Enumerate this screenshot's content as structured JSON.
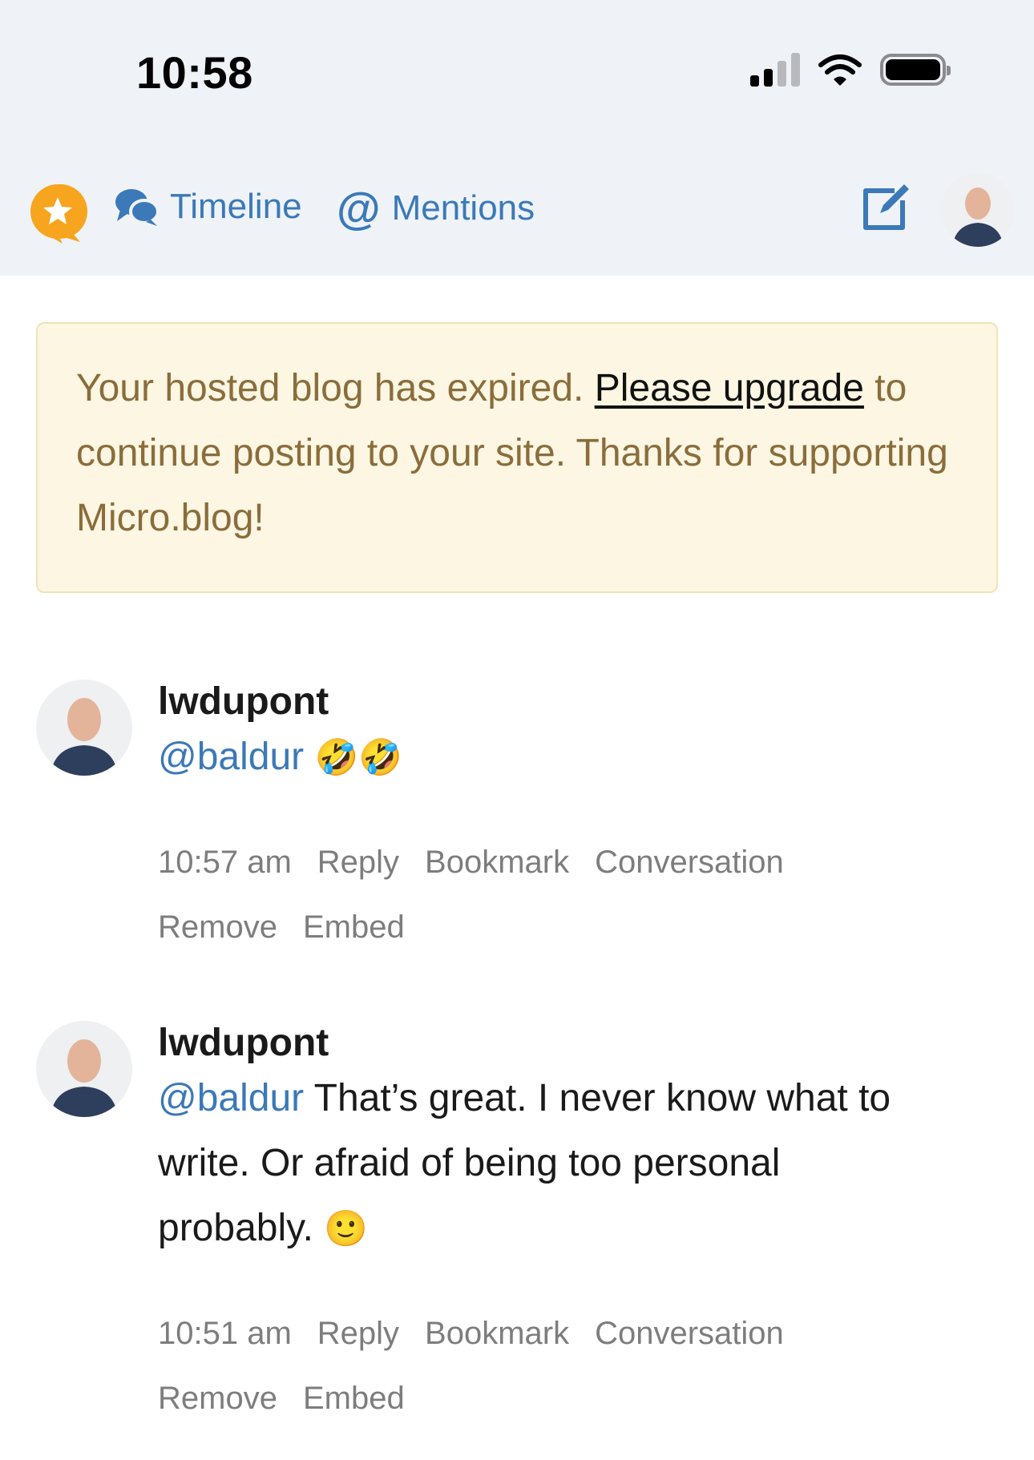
{
  "status": {
    "time": "10:58"
  },
  "nav": {
    "timeline": "Timeline",
    "mentions": "Mentions",
    "at_symbol": "@"
  },
  "banner": {
    "text_before": "Your hosted blog has expired. ",
    "link": "Please upgrade",
    "text_after": " to continue posting to your site. Thanks for supporting Micro.blog!"
  },
  "posts": [
    {
      "username": "lwdupont",
      "mention": "@baldur",
      "text": "",
      "emoji": "🤣🤣",
      "time": "10:57 am",
      "actions": [
        "Reply",
        "Bookmark",
        "Conversation",
        "Remove",
        "Embed"
      ]
    },
    {
      "username": "lwdupont",
      "mention": "@baldur",
      "text": " That’s great. I never know what to write. Or afraid of being too personal probably. ",
      "emoji": "🙂",
      "time": "10:51 am",
      "actions": [
        "Reply",
        "Bookmark",
        "Conversation",
        "Remove",
        "Embed"
      ]
    }
  ],
  "colors": {
    "accent": "#3b79b8",
    "banner_bg": "#fcf6e3",
    "banner_text": "#8a6d3b",
    "meta": "#7d7d7d"
  },
  "icons": {
    "star": "star-speech-badge-icon",
    "timeline": "speech-bubbles-icon",
    "compose": "compose-icon"
  }
}
